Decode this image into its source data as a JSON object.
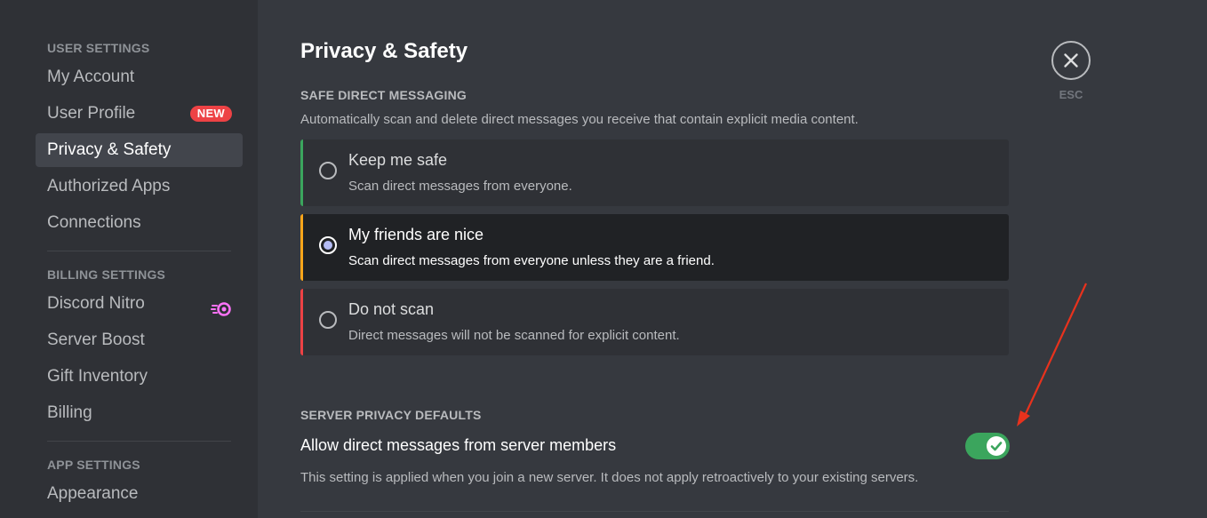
{
  "sidebar": {
    "user_settings_header": "USER SETTINGS",
    "user_items": [
      {
        "label": "My Account"
      },
      {
        "label": "User Profile",
        "badge": "NEW"
      },
      {
        "label": "Privacy & Safety",
        "active": true
      },
      {
        "label": "Authorized Apps"
      },
      {
        "label": "Connections"
      }
    ],
    "billing_settings_header": "BILLING SETTINGS",
    "billing_items": [
      {
        "label": "Discord Nitro",
        "icon": "nitro-icon"
      },
      {
        "label": "Server Boost"
      },
      {
        "label": "Gift Inventory"
      },
      {
        "label": "Billing"
      }
    ],
    "app_settings_header": "APP SETTINGS",
    "app_items": [
      {
        "label": "Appearance"
      }
    ]
  },
  "page": {
    "title": "Privacy & Safety",
    "close_label": "ESC",
    "safe_dm": {
      "header": "SAFE DIRECT MESSAGING",
      "description": "Automatically scan and delete direct messages you receive that contain explicit media content.",
      "options": [
        {
          "title": "Keep me safe",
          "description": "Scan direct messages from everyone.",
          "accent": "#3ba55d",
          "selected": false
        },
        {
          "title": "My friends are nice",
          "description": "Scan direct messages from everyone unless they are a friend.",
          "accent": "#faa61a",
          "selected": true
        },
        {
          "title": "Do not scan",
          "description": "Direct messages will not be scanned for explicit content.",
          "accent": "#ed4245",
          "selected": false
        }
      ]
    },
    "server_privacy": {
      "header": "SERVER PRIVACY DEFAULTS",
      "setting_label": "Allow direct messages from server members",
      "setting_enabled": true,
      "setting_description": "This setting is applied when you join a new server. It does not apply retroactively to your existing servers."
    }
  },
  "colors": {
    "toggle_on": "#3ba55d",
    "annotation_arrow": "#e8321d",
    "badge_new": "#ed4245",
    "nitro": "#ff73fa"
  }
}
